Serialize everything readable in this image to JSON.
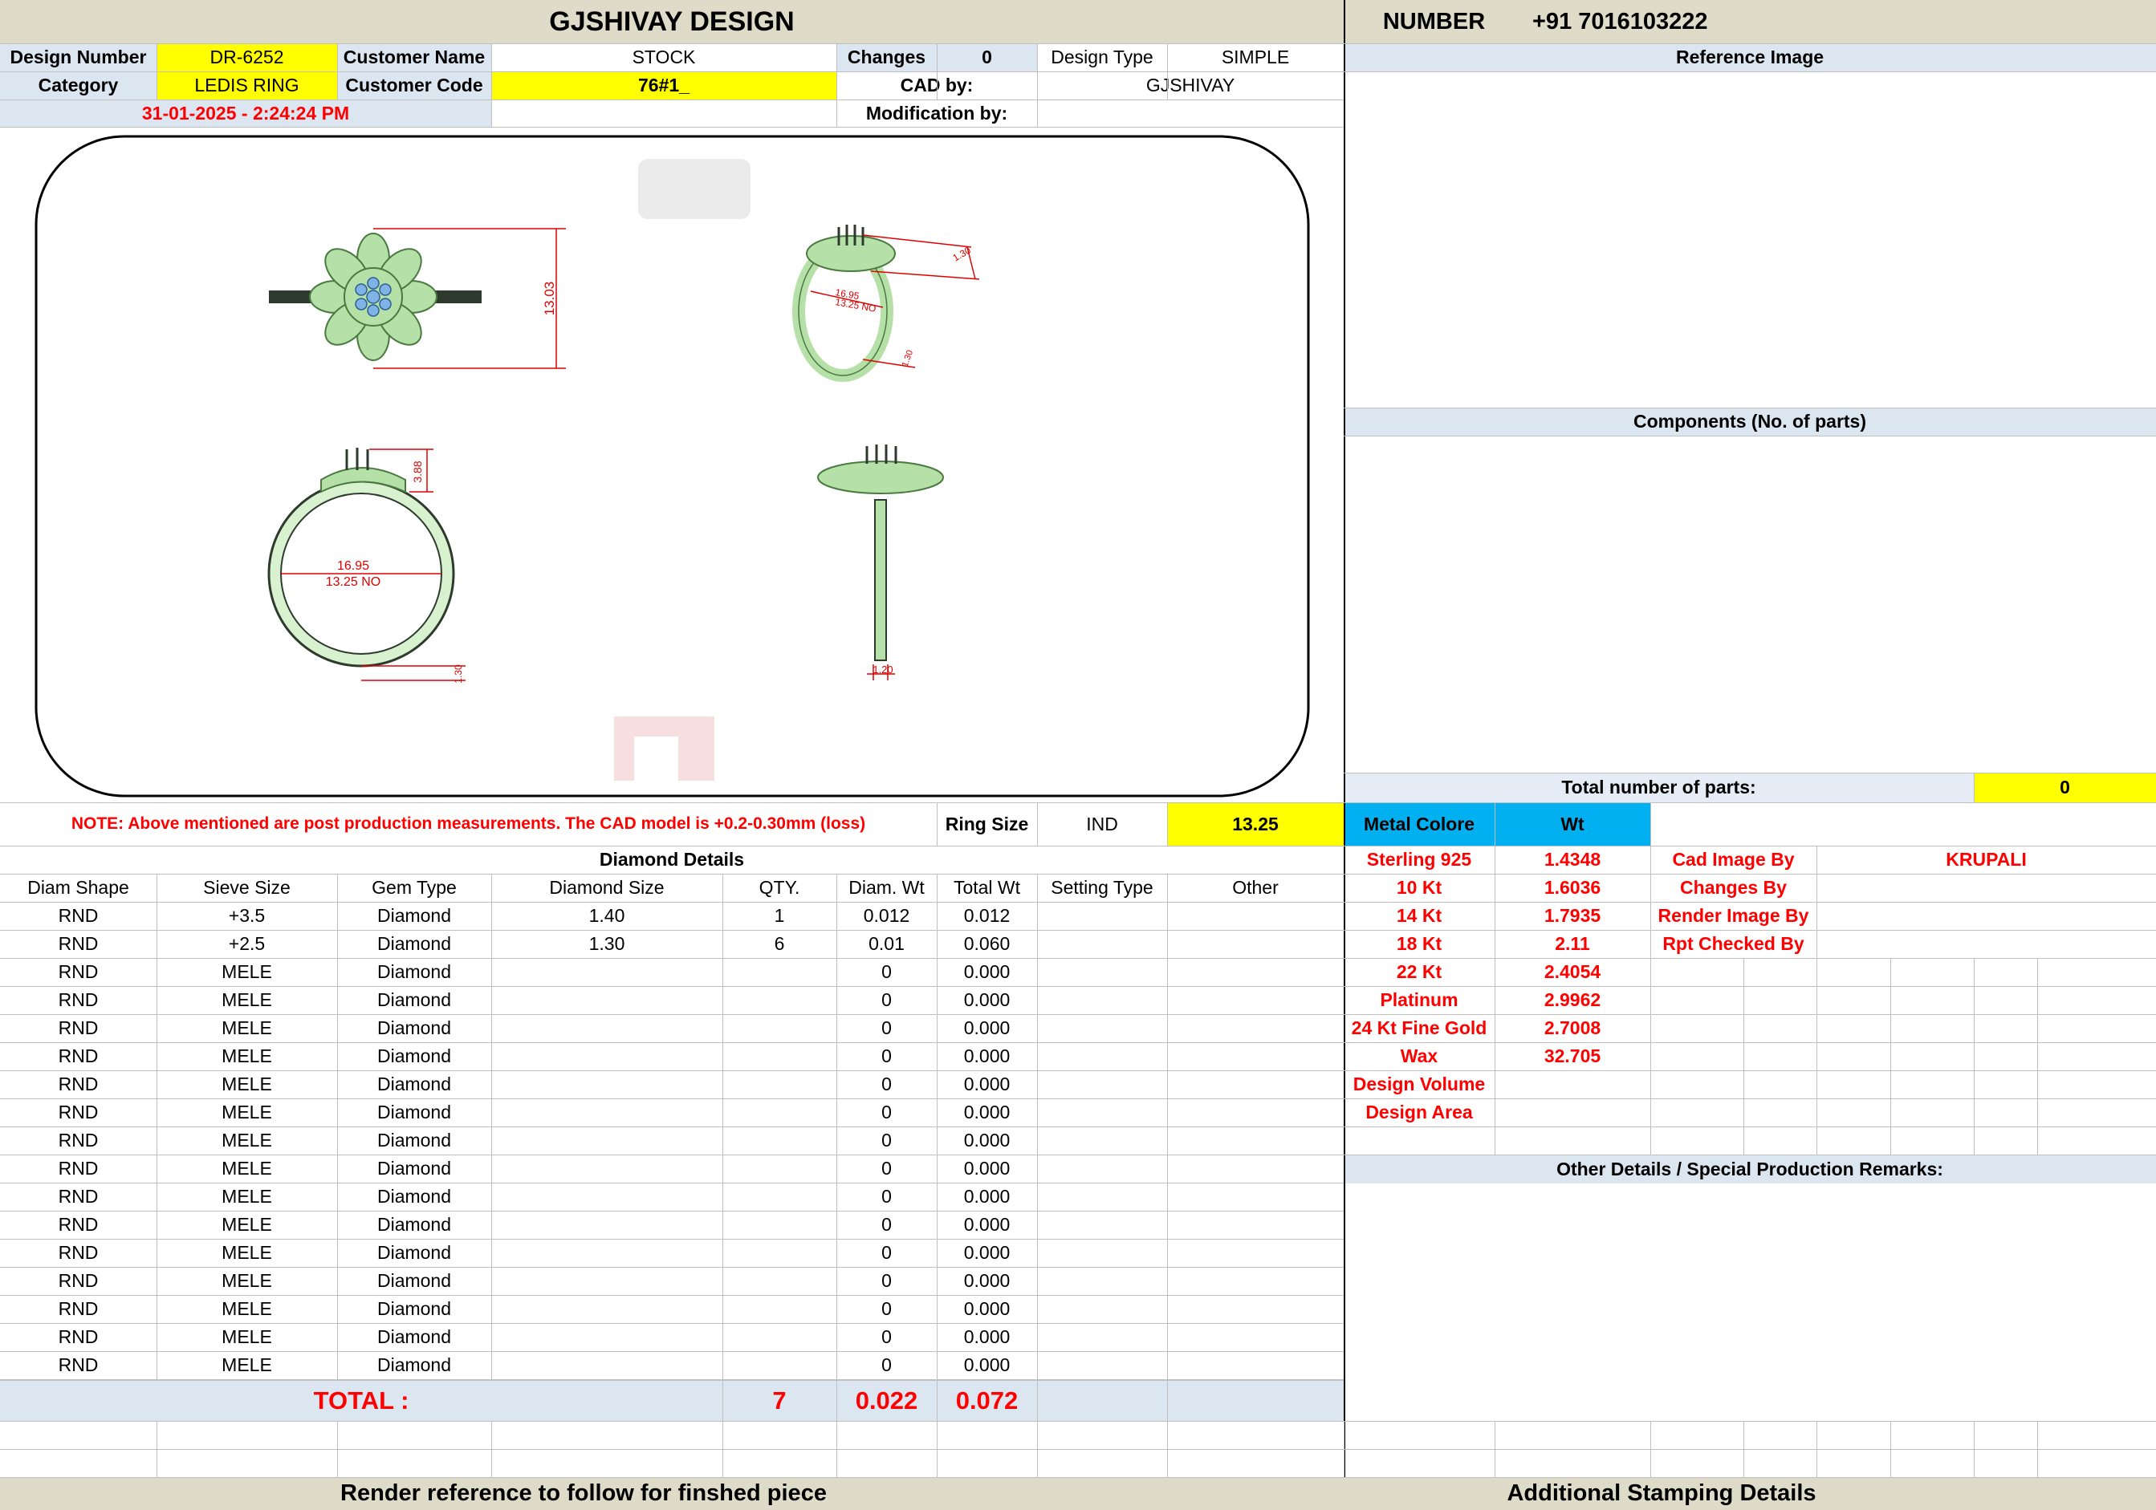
{
  "header": {
    "title": "GJSHIVAY DESIGN",
    "number_label": "NUMBER",
    "number_value": "+91 7016103222"
  },
  "info": {
    "design_number_label": "Design Number",
    "design_number": "DR-6252",
    "customer_name_label": "Customer Name",
    "customer_name": "STOCK",
    "changes_label": "Changes",
    "changes": "0",
    "design_type_label": "Design Type",
    "design_type": "SIMPLE",
    "category_label": "Category",
    "category": "LEDIS RING",
    "customer_code_label": "Customer Code",
    "customer_code": "76#1_",
    "cad_by_label": "CAD by:",
    "cad_by": "GJSHIVAY",
    "datetime": "31-01-2025 - 2:24:24 PM",
    "modification_label": "Modification by:",
    "modification_by": ""
  },
  "render": {
    "top_height": "13.03",
    "persp_width": "1.30",
    "persp_size_1": "16.95",
    "persp_size_2": "13.25 NO",
    "persp_band": "1.30",
    "side_height": "3.88",
    "side_size_1": "16.95",
    "side_size_2": "13.25 NO",
    "side_band": "1.30",
    "front_width": "1.20"
  },
  "right_panel": {
    "reference_image_label": "Reference Image",
    "components_label": "Components (No. of parts)",
    "total_parts_label": "Total number of parts:",
    "total_parts": "0",
    "metal_colore_label": "Metal Colore",
    "wt_label": "Wt",
    "other_details_label": "Other Details / Special Production Remarks:"
  },
  "note": {
    "text": "NOTE: Above mentioned are post production measurements. The CAD model is +0.2-0.30mm (loss)",
    "ring_size_label": "Ring Size",
    "ring_standard": "IND",
    "ring_size": "13.25"
  },
  "diamond_details": {
    "title": "Diamond Details",
    "headers": [
      "Diam Shape",
      "Sieve Size",
      "Gem Type",
      "Diamond Size",
      "QTY.",
      "Diam. Wt",
      "Total Wt",
      "Setting Type",
      "Other"
    ],
    "rows": [
      [
        "RND",
        "+3.5",
        "Diamond",
        "1.40",
        "1",
        "0.012",
        "0.012",
        "",
        ""
      ],
      [
        "RND",
        "+2.5",
        "Diamond",
        "1.30",
        "6",
        "0.01",
        "0.060",
        "",
        ""
      ],
      [
        "RND",
        "MELE",
        "Diamond",
        "",
        "",
        "0",
        "0.000",
        "",
        ""
      ],
      [
        "RND",
        "MELE",
        "Diamond",
        "",
        "",
        "0",
        "0.000",
        "",
        ""
      ],
      [
        "RND",
        "MELE",
        "Diamond",
        "",
        "",
        "0",
        "0.000",
        "",
        ""
      ],
      [
        "RND",
        "MELE",
        "Diamond",
        "",
        "",
        "0",
        "0.000",
        "",
        ""
      ],
      [
        "RND",
        "MELE",
        "Diamond",
        "",
        "",
        "0",
        "0.000",
        "",
        ""
      ],
      [
        "RND",
        "MELE",
        "Diamond",
        "",
        "",
        "0",
        "0.000",
        "",
        ""
      ],
      [
        "RND",
        "MELE",
        "Diamond",
        "",
        "",
        "0",
        "0.000",
        "",
        ""
      ],
      [
        "RND",
        "MELE",
        "Diamond",
        "",
        "",
        "0",
        "0.000",
        "",
        ""
      ],
      [
        "RND",
        "MELE",
        "Diamond",
        "",
        "",
        "0",
        "0.000",
        "",
        ""
      ],
      [
        "RND",
        "MELE",
        "Diamond",
        "",
        "",
        "0",
        "0.000",
        "",
        ""
      ],
      [
        "RND",
        "MELE",
        "Diamond",
        "",
        "",
        "0",
        "0.000",
        "",
        ""
      ],
      [
        "RND",
        "MELE",
        "Diamond",
        "",
        "",
        "0",
        "0.000",
        "",
        ""
      ],
      [
        "RND",
        "MELE",
        "Diamond",
        "",
        "",
        "0",
        "0.000",
        "",
        ""
      ],
      [
        "RND",
        "MELE",
        "Diamond",
        "",
        "",
        "0",
        "0.000",
        "",
        ""
      ],
      [
        "RND",
        "MELE",
        "Diamond",
        "",
        "",
        "0",
        "0.000",
        "",
        ""
      ]
    ],
    "total_label": "TOTAL :",
    "total_qty": "7",
    "total_diam_wt": "0.022",
    "total_wt": "0.072"
  },
  "metals": [
    {
      "name": "Sterling 925",
      "wt": "1.4348"
    },
    {
      "name": "10 Kt",
      "wt": "1.6036"
    },
    {
      "name": "14 Kt",
      "wt": "1.7935"
    },
    {
      "name": "18 Kt",
      "wt": "2.11"
    },
    {
      "name": "22 Kt",
      "wt": "2.4054"
    },
    {
      "name": "Platinum",
      "wt": "2.9962"
    },
    {
      "name": "24 Kt Fine Gold",
      "wt": "2.7008"
    },
    {
      "name": "Wax",
      "wt": "32.705"
    },
    {
      "name": "Design Volume",
      "wt": ""
    },
    {
      "name": "Design Area",
      "wt": ""
    }
  ],
  "credits": [
    {
      "label": "Cad Image By",
      "value": "KRUPALI"
    },
    {
      "label": "Changes By",
      "value": ""
    },
    {
      "label": "Render Image By",
      "value": ""
    },
    {
      "label": "Rpt Checked By",
      "value": ""
    }
  ],
  "footer": {
    "left": "Render reference to follow for finshed piece",
    "right": "Additional Stamping Details"
  },
  "colors": {
    "header_beige": "#dedbc9",
    "highlight_yellow": "#ffff00",
    "label_blue": "#dce6f1",
    "metal_cyan": "#00b0f0",
    "alert_red": "#ff0000",
    "ring_green": "#b5e0a8",
    "stone_blue": "#7fb3e6",
    "dimension_red": "#e00000"
  }
}
